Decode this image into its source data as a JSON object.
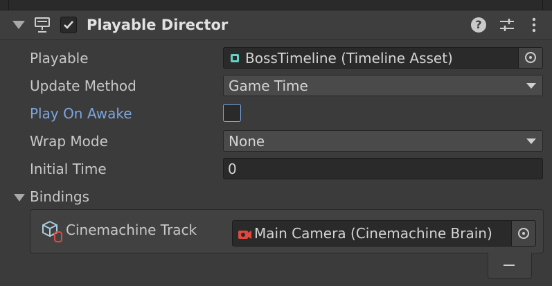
{
  "component": {
    "title": "Playable Director",
    "enabled": true,
    "icons": {
      "foldout": "foldout-triangle-icon",
      "component": "playable-director-icon",
      "help": "help-icon",
      "preset": "preset-icon",
      "menu": "kebab-menu-icon"
    },
    "help_glyph": "?"
  },
  "fields": {
    "playable": {
      "label": "Playable",
      "value": "BossTimeline (Timeline Asset)",
      "icon": "timeline-asset-icon"
    },
    "update_method": {
      "label": "Update Method",
      "value": "Game Time"
    },
    "play_on_awake": {
      "label": "Play On Awake",
      "checked": false
    },
    "wrap_mode": {
      "label": "Wrap Mode",
      "value": "None"
    },
    "initial_time": {
      "label": "Initial Time",
      "value": "0"
    }
  },
  "bindings": {
    "label": "Bindings",
    "items": [
      {
        "track": "Cinemachine Track",
        "track_icon": "cinemachine-track-icon",
        "value": "Main Camera (Cinemachine Brain)",
        "value_icon": "cinemachine-brain-icon"
      }
    ],
    "remove_glyph": "−"
  },
  "colors": {
    "panel_bg": "#3b3b3b",
    "field_bg": "#2a2a2a",
    "accent_label": "#7ba6e0",
    "cinemachine_red": "#e0473e",
    "timeline_teal": "#5fd3c8"
  }
}
